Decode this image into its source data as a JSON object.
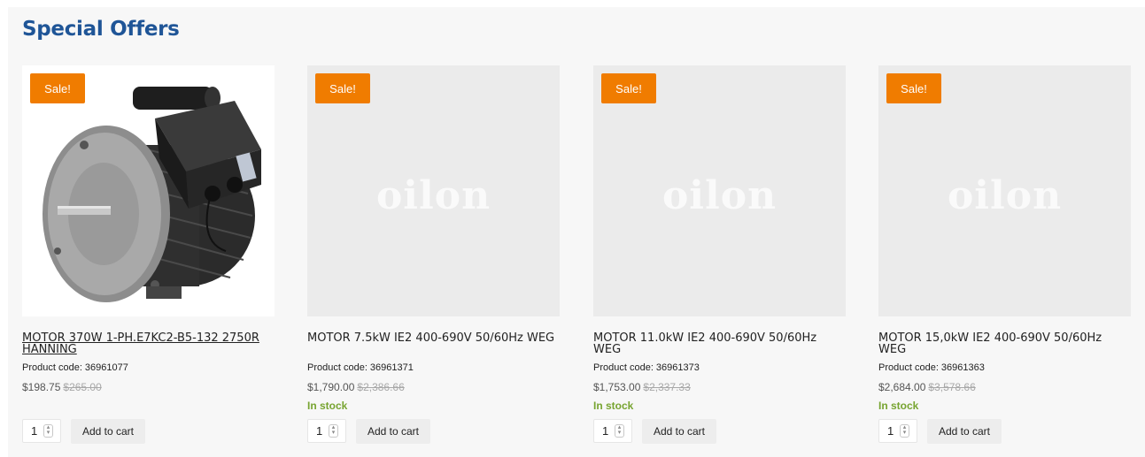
{
  "section": {
    "title": "Special Offers",
    "title_color": "#1f5597",
    "sale_color": "#f07c00",
    "stock_color": "#77a430"
  },
  "products": [
    {
      "badge": "Sale!",
      "name": "MOTOR 370W 1-PH.E7KC2-B5-132 2750R HANNING",
      "code": "Product code: 36961077",
      "price": "$198.75",
      "old_price": "$265.00",
      "stock": "",
      "qty": "1",
      "cart_label": "Add to cart",
      "image": "electric-motor-photo"
    },
    {
      "badge": "Sale!",
      "name": "MOTOR 7.5kW IE2 400-690V 50/60Hz WEG",
      "code": "Product code: 36961371",
      "price": "$1,790.00",
      "old_price": "$2,386.66",
      "stock": "In stock",
      "qty": "1",
      "cart_label": "Add to cart",
      "placeholder_text": "oilon"
    },
    {
      "badge": "Sale!",
      "name": "MOTOR 11.0kW IE2 400-690V 50/60Hz WEG",
      "code": "Product code: 36961373",
      "price": "$1,753.00",
      "old_price": "$2,337.33",
      "stock": "In stock",
      "qty": "1",
      "cart_label": "Add to cart",
      "placeholder_text": "oilon"
    },
    {
      "badge": "Sale!",
      "name": "MOTOR 15,0kW IE2 400-690V 50/60Hz WEG",
      "code": "Product code: 36961363",
      "price": "$2,684.00",
      "old_price": "$3,578.66",
      "stock": "In stock",
      "qty": "1",
      "cart_label": "Add to cart",
      "placeholder_text": "oilon"
    }
  ]
}
